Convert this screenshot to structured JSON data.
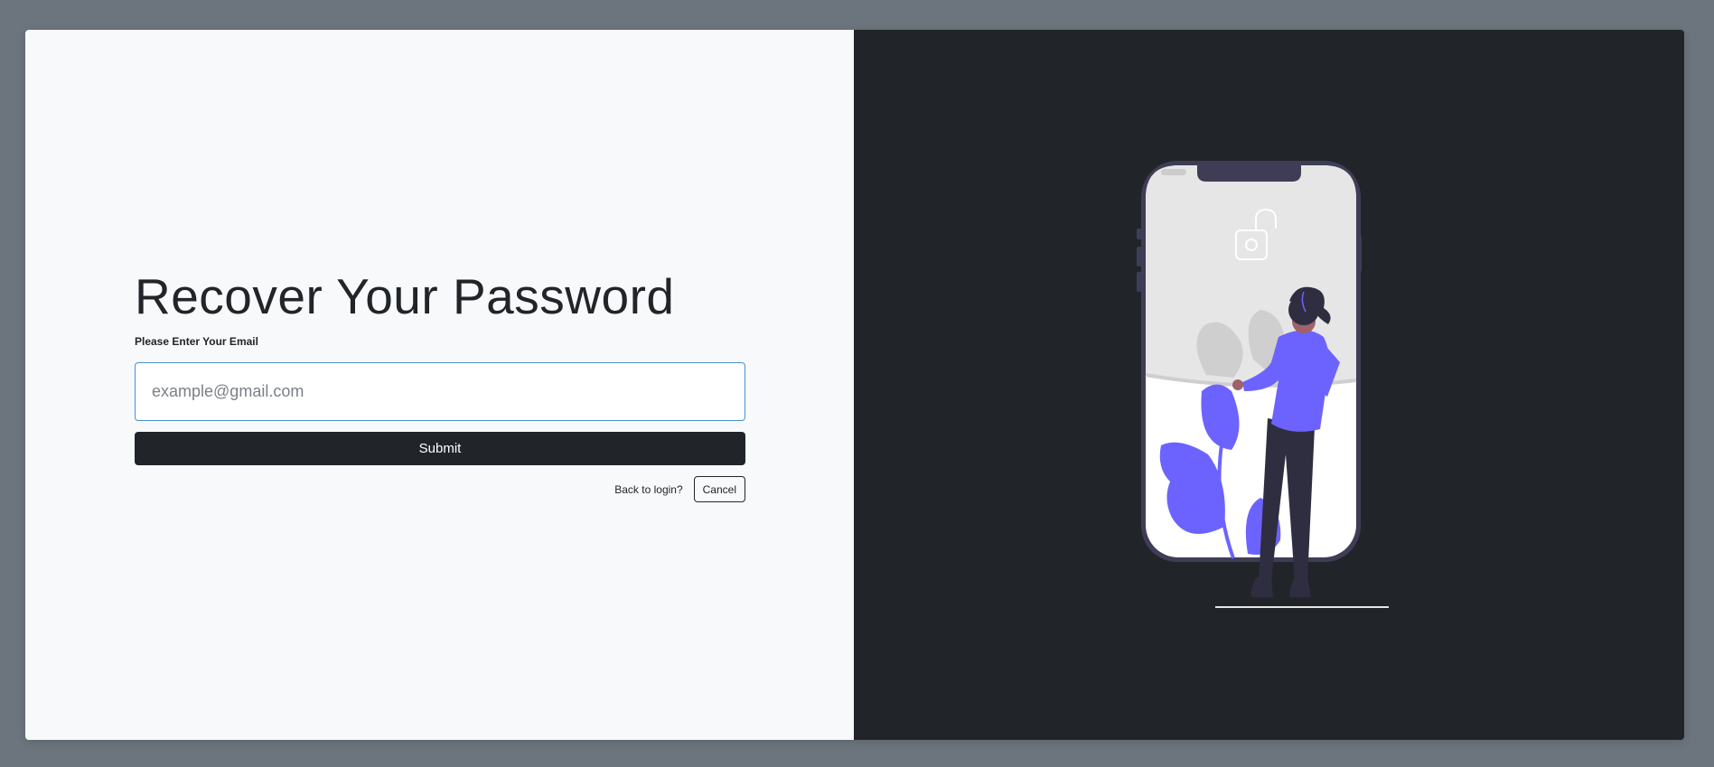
{
  "form": {
    "title": "Recover Your Password",
    "email_label": "Please Enter Your Email",
    "email_placeholder": "example@gmail.com",
    "email_value": "",
    "submit_label": "Submit",
    "back_text": "Back to login?",
    "cancel_label": "Cancel"
  },
  "illustration": {
    "icon": "woman-unlocking-phone-illustration",
    "accent_color": "#6c63ff"
  },
  "colors": {
    "page_bg": "#6c757d",
    "left_panel": "#f8f9fa",
    "right_panel": "#212529",
    "primary_dark": "#212529"
  }
}
